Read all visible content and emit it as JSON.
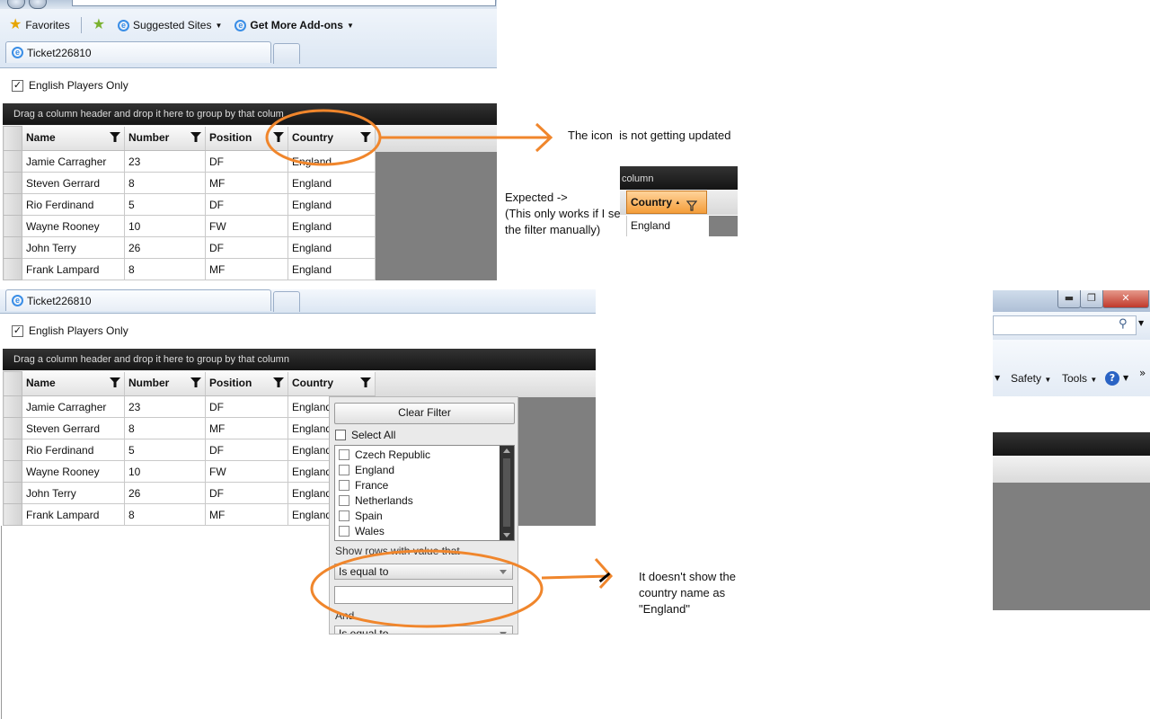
{
  "browser": {
    "favorites_label": "Favorites",
    "suggested_label": "Suggested Sites",
    "addons_label": "Get More Add-ons",
    "tab_title": "Ticket226810",
    "menu_safety": "Safety",
    "menu_tools": "Tools",
    "help_label": "?",
    "chevron": "»"
  },
  "grid": {
    "checkbox_label": "English Players Only",
    "group_hint": "Drag a column header and drop it here to group by that column",
    "group_hint_clipped": "Drag a column header and drop it here to group by that colum",
    "columns": [
      "Name",
      "Number",
      "Position",
      "Country"
    ],
    "rows": [
      [
        "Jamie Carragher",
        "23",
        "DF",
        "England"
      ],
      [
        "Steven Gerrard",
        "8",
        "MF",
        "England"
      ],
      [
        "Rio Ferdinand",
        "5",
        "DF",
        "England"
      ],
      [
        "Wayne Rooney",
        "10",
        "FW",
        "England"
      ],
      [
        "John Terry",
        "26",
        "DF",
        "England"
      ],
      [
        "Frank Lampard",
        "8",
        "MF",
        "England"
      ]
    ]
  },
  "annotations": {
    "top_note_a": "The icon",
    "top_note_b": "is not getting updated",
    "expected_line1": "Expected ->",
    "expected_line2": "(This only works if I set",
    "expected_line3": "the filter manually)",
    "bottom_note_1": "It doesn't show the",
    "bottom_note_2": "country name as",
    "bottom_note_3": "\"England\"",
    "accent_color": "#f0862c"
  },
  "expected_snippet": {
    "header_text": "column",
    "column_label": "Country",
    "sort_glyph": "▲",
    "cell_value": "England"
  },
  "filter_popup": {
    "clear_label": "Clear Filter",
    "select_all_label": "Select All",
    "options": [
      "Czech Republic",
      "England",
      "France",
      "Netherlands",
      "Spain",
      "Wales"
    ],
    "condition_label": "Show rows with value that",
    "operator_1": "Is equal to",
    "value_1": "",
    "logic_label": "And",
    "operator_2": "Is equal to"
  }
}
